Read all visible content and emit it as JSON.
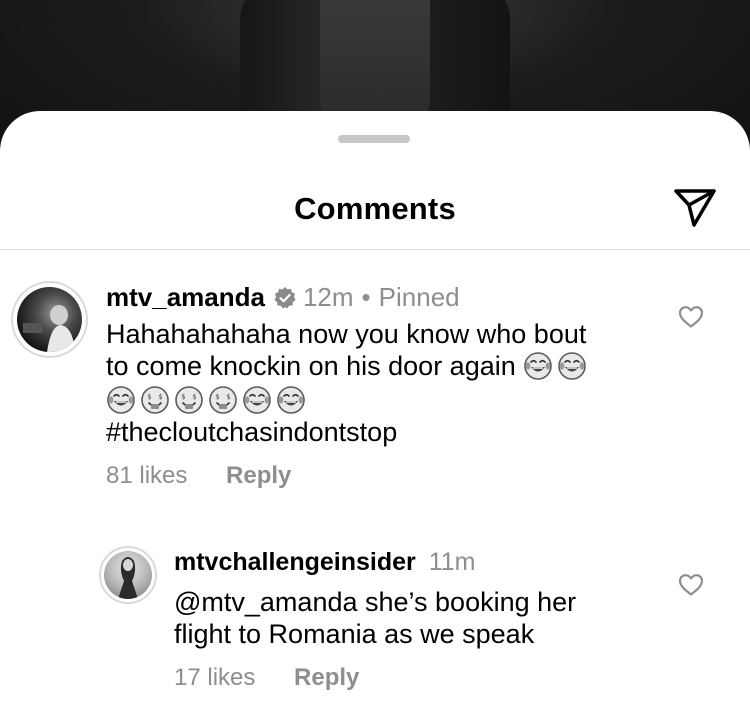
{
  "sheet": {
    "title": "Comments"
  },
  "comments": [
    {
      "username": "mtv_amanda",
      "time": "12m",
      "separator": "•",
      "pinned": "Pinned",
      "text_line1": "Hahahahahaha now you know who bout",
      "text_line2": "to come knockin on his door again",
      "hashtag": "#thecloutchasindontstop",
      "likes": "81 likes",
      "reply": "Reply",
      "emojis_line2": [
        "joy",
        "joy"
      ],
      "emojis_line3": [
        "joy",
        "money-mouth",
        "money-mouth",
        "money-mouth",
        "joy",
        "joy"
      ]
    },
    {
      "username": "mtvchallengeinsider",
      "time": "11m",
      "text_line1": "@mtv_amanda she’s booking her",
      "text_line2": "flight to Romania as we speak",
      "likes": "17 likes",
      "reply": "Reply"
    }
  ],
  "icons": {
    "send": "paper-plane-icon",
    "like": "heart-outline-icon",
    "verified": "verified-badge-icon"
  },
  "colors": {
    "meta": "#8e8e8e",
    "divider": "#dcdcdc",
    "grabber": "#c7c7c7"
  }
}
